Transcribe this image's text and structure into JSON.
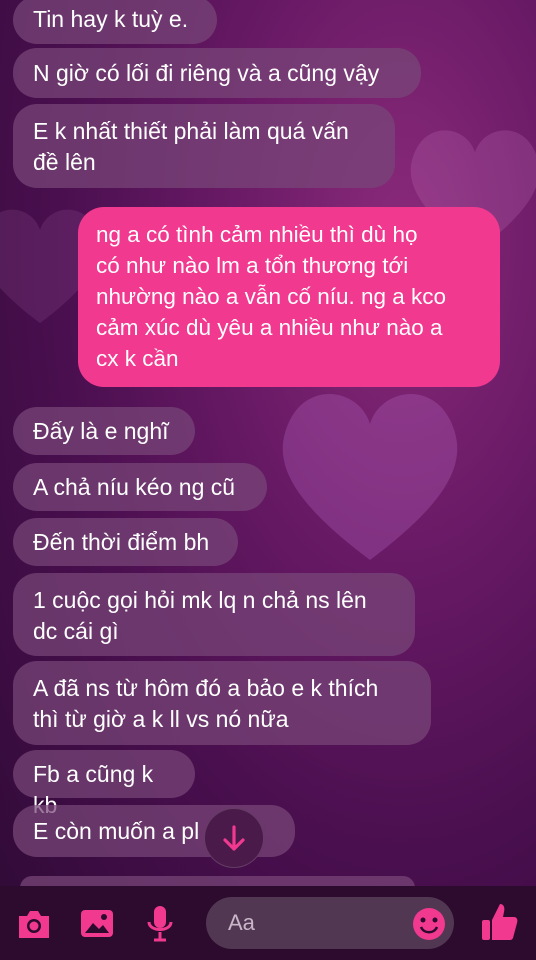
{
  "messages": [
    {
      "side": "received",
      "text": "Tin hay k tuỳ e."
    },
    {
      "side": "received",
      "text": "N giờ có lối đi riêng và a cũng vậy"
    },
    {
      "side": "received",
      "text": "E k nhất thiết phải làm quá vấn\nđề lên"
    },
    {
      "side": "sent",
      "text": "ng a có tình cảm nhiều thì dù họ\ncó như nào lm a tổn thương tới\nnhường nào a vẫn cố níu. ng a kco\ncảm xúc dù yêu a nhiều như nào a\ncx k cần"
    },
    {
      "side": "received",
      "text": "Đấy là e nghĩ"
    },
    {
      "side": "received",
      "text": "A chả níu kéo ng cũ"
    },
    {
      "side": "received",
      "text": "Đến thời điểm bh"
    },
    {
      "side": "received",
      "text": "1 cuộc gọi hỏi mk lq n chả ns lên\ndc cái gì"
    },
    {
      "side": "received",
      "text": "A đã ns từ hôm đó a bảo e k thích\nthì từ giờ a k ll vs nó nữa"
    },
    {
      "side": "received",
      "text": "Fb a cũng k kb"
    },
    {
      "side": "received",
      "text": "E còn muốn a pl      n"
    }
  ],
  "composer": {
    "placeholder": "Aa",
    "icons": [
      "camera-icon",
      "gallery-icon",
      "microphone-icon",
      "emoji-icon",
      "like-icon"
    ]
  },
  "scroll_button": {
    "icon": "arrow-down-icon"
  },
  "colors": {
    "sent_bubble": "#f0398f",
    "received_bubble": "#7a4a7a",
    "accent_icon": "#f0398f",
    "background": "#4a0f4f"
  }
}
